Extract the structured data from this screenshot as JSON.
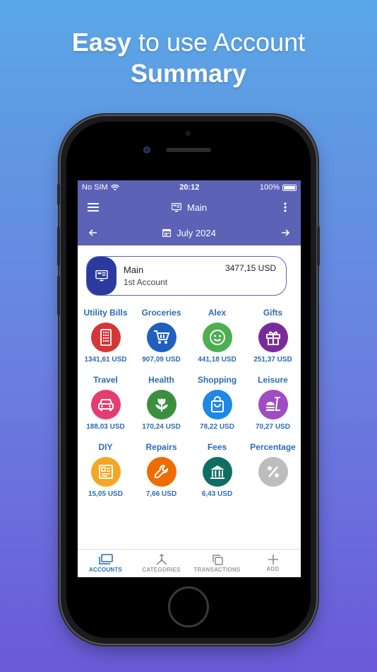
{
  "headline": {
    "line1_bold": "Easy",
    "line1_rest": " to use Account",
    "line2": "Summary"
  },
  "status": {
    "carrier": "No SIM",
    "time": "20:12",
    "battery": "100%"
  },
  "appbar": {
    "title": "Main",
    "month": "July 2024"
  },
  "account": {
    "name": "Main",
    "subtitle": "1st Account",
    "balance": "3477,15 USD"
  },
  "categories": [
    {
      "label": "Utility Bills",
      "amount": "1341,61 USD",
      "color": "#d63638",
      "icon": "building-icon"
    },
    {
      "label": "Groceries",
      "amount": "907,09 USD",
      "color": "#1f5fbf",
      "icon": "cart-icon"
    },
    {
      "label": "Alex",
      "amount": "441,18 USD",
      "color": "#4caf50",
      "icon": "smile-icon"
    },
    {
      "label": "Gifts",
      "amount": "251,37 USD",
      "color": "#7b2a9c",
      "icon": "gift-icon"
    },
    {
      "label": "Travel",
      "amount": "188,03 USD",
      "color": "#e53d6f",
      "icon": "car-icon"
    },
    {
      "label": "Health",
      "amount": "170,24 USD",
      "color": "#3c8f3f",
      "icon": "flower-icon"
    },
    {
      "label": "Shopping",
      "amount": "78,22 USD",
      "color": "#1e88e5",
      "icon": "bag-icon"
    },
    {
      "label": "Leisure",
      "amount": "70,27 USD",
      "color": "#a04cc2",
      "icon": "food-icon"
    },
    {
      "label": "DIY",
      "amount": "15,05 USD",
      "color": "#f5a623",
      "icon": "blueprint-icon"
    },
    {
      "label": "Repairs",
      "amount": "7,66 USD",
      "color": "#ef6c00",
      "icon": "wrench-icon"
    },
    {
      "label": "Fees",
      "amount": "6,43 USD",
      "color": "#0f6e63",
      "icon": "bank-icon"
    },
    {
      "label": "Percentage",
      "amount": "",
      "color": "#bdbdbd",
      "icon": "percent-icon"
    }
  ],
  "nav": [
    {
      "label": "ACCOUNTS",
      "icon": "accounts-icon",
      "active": true
    },
    {
      "label": "CATEGORIES",
      "icon": "categories-icon",
      "active": false
    },
    {
      "label": "TRANSACTIONS",
      "icon": "transactions-icon",
      "active": false
    },
    {
      "label": "ADD",
      "icon": "add-icon",
      "active": false
    }
  ]
}
